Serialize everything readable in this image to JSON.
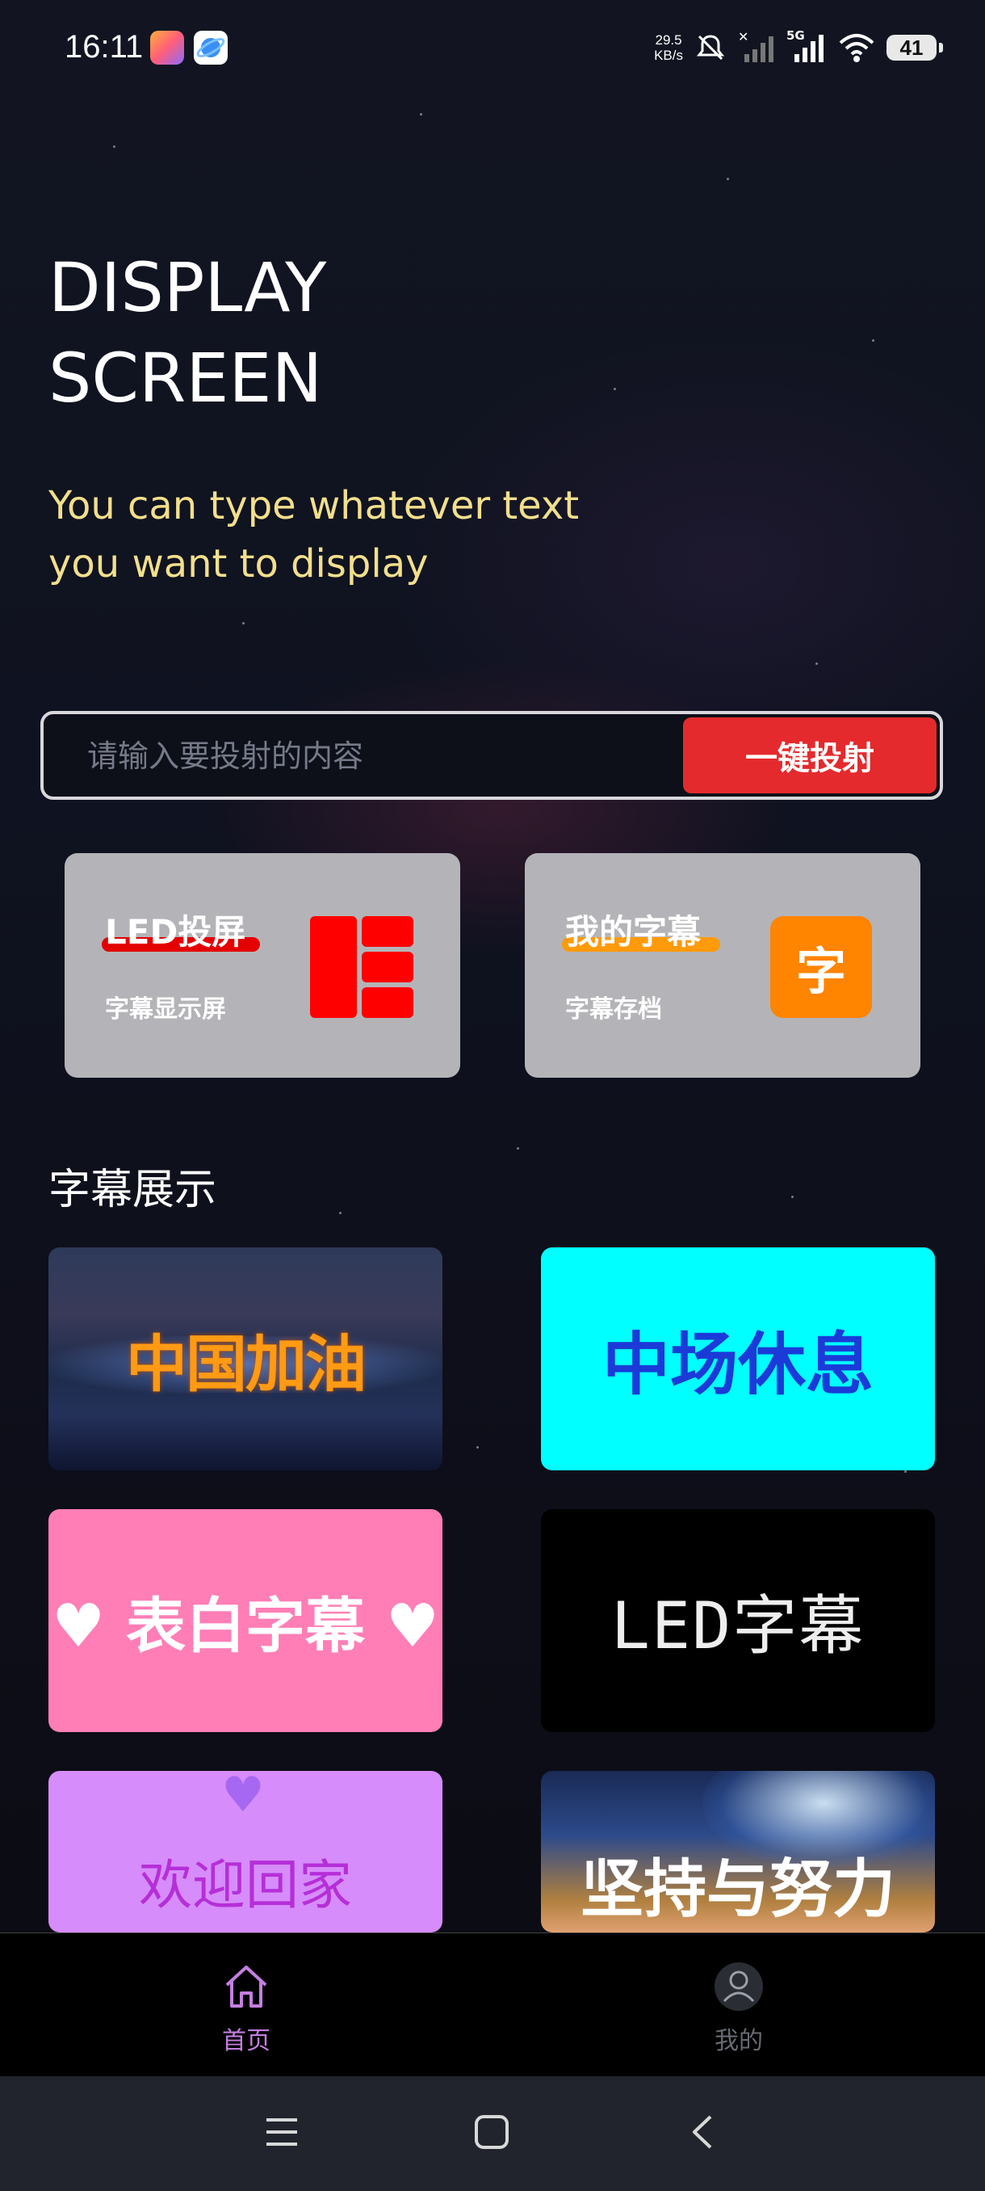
{
  "status_bar": {
    "time": "16:11",
    "net_speed_value": "29.5",
    "net_speed_unit": "KB/s",
    "network": "5G",
    "battery": "41",
    "icons": [
      "game-app-icon",
      "planet-app-icon",
      "mute-icon",
      "no-signal-icon",
      "signal-icon",
      "wifi-icon",
      "battery-icon"
    ]
  },
  "header": {
    "title_line1": "DISPLAY",
    "title_line2": "SCREEN",
    "subtitle": "You can type whatever text you want to display"
  },
  "search": {
    "placeholder": "请输入要投射的内容",
    "value": "",
    "button_label": "一键投射"
  },
  "feature_cards": [
    {
      "title": "LED投屏",
      "subtitle": "字幕显示屏",
      "icon": "grid-tiles-icon",
      "accent": "#ff0000"
    },
    {
      "title": "我的字幕",
      "subtitle": "字幕存档",
      "icon_text": "字",
      "accent": "#ff8400"
    }
  ],
  "section": {
    "title": "字幕展示"
  },
  "showcase": [
    {
      "text": "中国加油"
    },
    {
      "text": "中场休息"
    },
    {
      "text": "♥ 表白字幕 ♥"
    },
    {
      "text": "LED字幕"
    },
    {
      "text": "欢迎回家"
    },
    {
      "text": "坚持与努力"
    }
  ],
  "tabbar": {
    "items": [
      {
        "label": "首页",
        "icon": "home-icon",
        "active": true,
        "color": "#c47fe0"
      },
      {
        "label": "我的",
        "icon": "user-icon",
        "active": false,
        "color": "#666a72"
      }
    ]
  },
  "nav": {
    "icons": [
      "menu-icon",
      "home-square-icon",
      "back-icon"
    ]
  }
}
